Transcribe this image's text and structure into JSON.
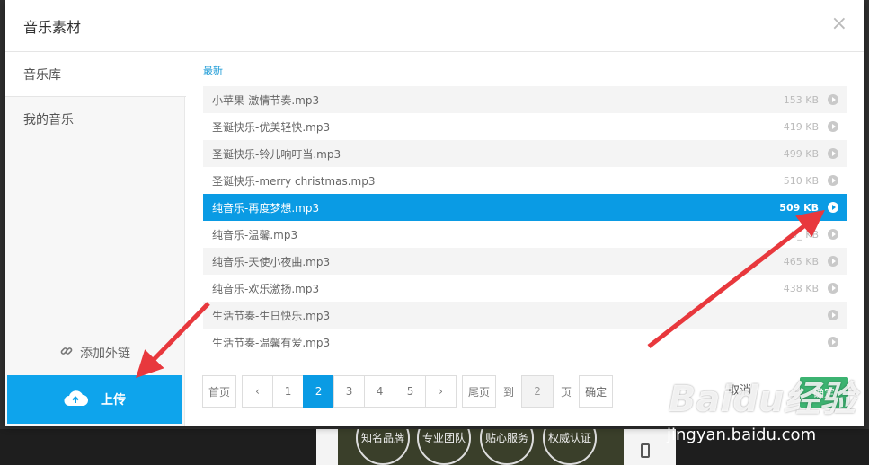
{
  "modal": {
    "title": "音乐素材",
    "close": "×"
  },
  "sidebar": {
    "items": [
      {
        "label": "音乐库",
        "active": true
      },
      {
        "label": "我的音乐",
        "active": false
      }
    ],
    "external_link_label": "添加外链",
    "upload_label": "上传"
  },
  "content": {
    "section_label": "最新",
    "tracks": [
      {
        "name": "小苹果-激情节奏.mp3",
        "size": "153 KB"
      },
      {
        "name": "圣诞快乐-优美轻快.mp3",
        "size": "419 KB"
      },
      {
        "name": "圣诞快乐-铃儿响叮当.mp3",
        "size": "499 KB"
      },
      {
        "name": "圣诞快乐-merry christmas.mp3",
        "size": "510 KB"
      },
      {
        "name": "纯音乐-再度梦想.mp3",
        "size": "509 KB",
        "selected": true
      },
      {
        "name": "纯音乐-温馨.mp3",
        "size": "5_ KB"
      },
      {
        "name": "纯音乐-天使小夜曲.mp3",
        "size": "465 KB"
      },
      {
        "name": "纯音乐-欢乐激扬.mp3",
        "size": "438 KB"
      },
      {
        "name": "生活节奏-生日快乐.mp3",
        "size": ""
      },
      {
        "name": "生活节奏-温馨有爱.mp3",
        "size": ""
      }
    ]
  },
  "pager": {
    "first": "首页",
    "prev": "‹",
    "pages": [
      "1",
      "2",
      "3",
      "4",
      "5"
    ],
    "current": "2",
    "next": "›",
    "last": "尾页",
    "goto_prefix": "到",
    "goto_value": "2",
    "goto_suffix": "页",
    "goto_confirm": "确定"
  },
  "footer": {
    "cancel_label": "取消",
    "ok_label": "确定"
  },
  "background": {
    "badges": [
      "知名品牌",
      "专业团队",
      "贴心服务",
      "权威认证"
    ]
  },
  "watermark": {
    "logo": "Baidu经验",
    "url": "jingyan.baidu.com"
  },
  "colors": {
    "accent": "#0a9be4",
    "upload": "#0ea4ec",
    "ok": "#3cb371",
    "arrow": "#e8383d"
  }
}
